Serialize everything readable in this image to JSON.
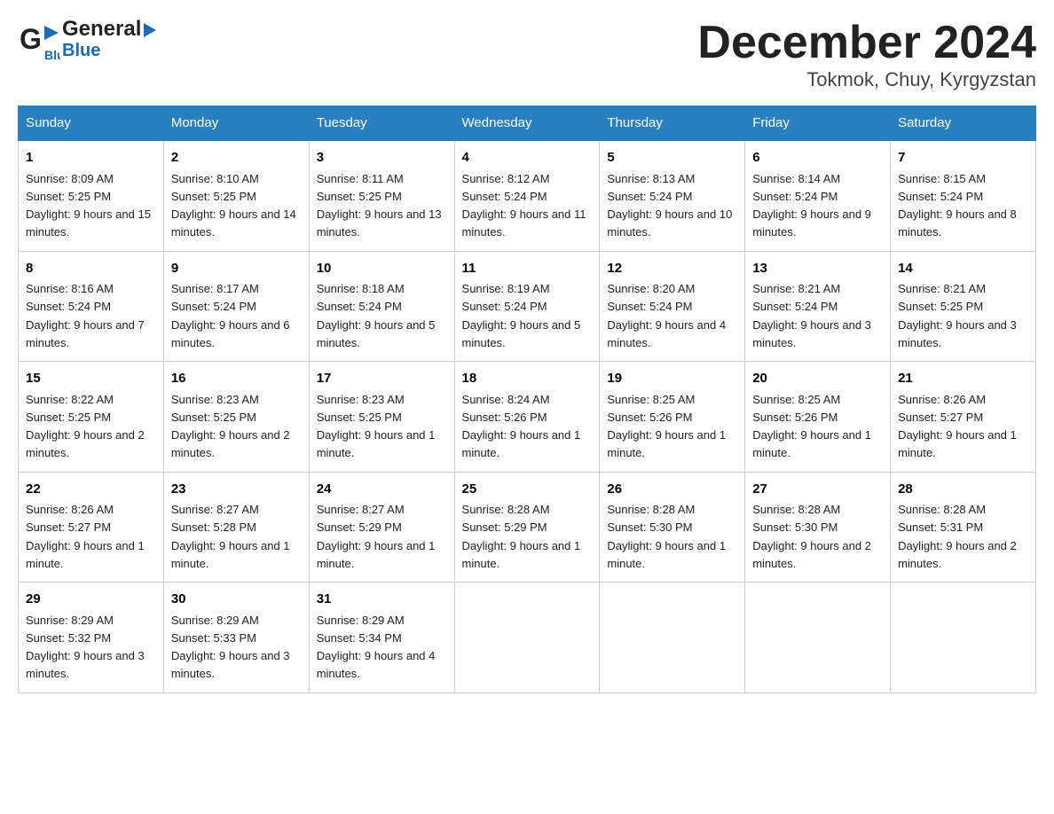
{
  "header": {
    "logo_general": "General",
    "logo_blue": "Blue",
    "title": "December 2024",
    "subtitle": "Tokmok, Chuy, Kyrgyzstan"
  },
  "days_of_week": [
    "Sunday",
    "Monday",
    "Tuesday",
    "Wednesday",
    "Thursday",
    "Friday",
    "Saturday"
  ],
  "weeks": [
    [
      {
        "num": "1",
        "sunrise": "8:09 AM",
        "sunset": "5:25 PM",
        "daylight": "9 hours and 15 minutes."
      },
      {
        "num": "2",
        "sunrise": "8:10 AM",
        "sunset": "5:25 PM",
        "daylight": "9 hours and 14 minutes."
      },
      {
        "num": "3",
        "sunrise": "8:11 AM",
        "sunset": "5:25 PM",
        "daylight": "9 hours and 13 minutes."
      },
      {
        "num": "4",
        "sunrise": "8:12 AM",
        "sunset": "5:24 PM",
        "daylight": "9 hours and 11 minutes."
      },
      {
        "num": "5",
        "sunrise": "8:13 AM",
        "sunset": "5:24 PM",
        "daylight": "9 hours and 10 minutes."
      },
      {
        "num": "6",
        "sunrise": "8:14 AM",
        "sunset": "5:24 PM",
        "daylight": "9 hours and 9 minutes."
      },
      {
        "num": "7",
        "sunrise": "8:15 AM",
        "sunset": "5:24 PM",
        "daylight": "9 hours and 8 minutes."
      }
    ],
    [
      {
        "num": "8",
        "sunrise": "8:16 AM",
        "sunset": "5:24 PM",
        "daylight": "9 hours and 7 minutes."
      },
      {
        "num": "9",
        "sunrise": "8:17 AM",
        "sunset": "5:24 PM",
        "daylight": "9 hours and 6 minutes."
      },
      {
        "num": "10",
        "sunrise": "8:18 AM",
        "sunset": "5:24 PM",
        "daylight": "9 hours and 5 minutes."
      },
      {
        "num": "11",
        "sunrise": "8:19 AM",
        "sunset": "5:24 PM",
        "daylight": "9 hours and 5 minutes."
      },
      {
        "num": "12",
        "sunrise": "8:20 AM",
        "sunset": "5:24 PM",
        "daylight": "9 hours and 4 minutes."
      },
      {
        "num": "13",
        "sunrise": "8:21 AM",
        "sunset": "5:24 PM",
        "daylight": "9 hours and 3 minutes."
      },
      {
        "num": "14",
        "sunrise": "8:21 AM",
        "sunset": "5:25 PM",
        "daylight": "9 hours and 3 minutes."
      }
    ],
    [
      {
        "num": "15",
        "sunrise": "8:22 AM",
        "sunset": "5:25 PM",
        "daylight": "9 hours and 2 minutes."
      },
      {
        "num": "16",
        "sunrise": "8:23 AM",
        "sunset": "5:25 PM",
        "daylight": "9 hours and 2 minutes."
      },
      {
        "num": "17",
        "sunrise": "8:23 AM",
        "sunset": "5:25 PM",
        "daylight": "9 hours and 1 minute."
      },
      {
        "num": "18",
        "sunrise": "8:24 AM",
        "sunset": "5:26 PM",
        "daylight": "9 hours and 1 minute."
      },
      {
        "num": "19",
        "sunrise": "8:25 AM",
        "sunset": "5:26 PM",
        "daylight": "9 hours and 1 minute."
      },
      {
        "num": "20",
        "sunrise": "8:25 AM",
        "sunset": "5:26 PM",
        "daylight": "9 hours and 1 minute."
      },
      {
        "num": "21",
        "sunrise": "8:26 AM",
        "sunset": "5:27 PM",
        "daylight": "9 hours and 1 minute."
      }
    ],
    [
      {
        "num": "22",
        "sunrise": "8:26 AM",
        "sunset": "5:27 PM",
        "daylight": "9 hours and 1 minute."
      },
      {
        "num": "23",
        "sunrise": "8:27 AM",
        "sunset": "5:28 PM",
        "daylight": "9 hours and 1 minute."
      },
      {
        "num": "24",
        "sunrise": "8:27 AM",
        "sunset": "5:29 PM",
        "daylight": "9 hours and 1 minute."
      },
      {
        "num": "25",
        "sunrise": "8:28 AM",
        "sunset": "5:29 PM",
        "daylight": "9 hours and 1 minute."
      },
      {
        "num": "26",
        "sunrise": "8:28 AM",
        "sunset": "5:30 PM",
        "daylight": "9 hours and 1 minute."
      },
      {
        "num": "27",
        "sunrise": "8:28 AM",
        "sunset": "5:30 PM",
        "daylight": "9 hours and 2 minutes."
      },
      {
        "num": "28",
        "sunrise": "8:28 AM",
        "sunset": "5:31 PM",
        "daylight": "9 hours and 2 minutes."
      }
    ],
    [
      {
        "num": "29",
        "sunrise": "8:29 AM",
        "sunset": "5:32 PM",
        "daylight": "9 hours and 3 minutes."
      },
      {
        "num": "30",
        "sunrise": "8:29 AM",
        "sunset": "5:33 PM",
        "daylight": "9 hours and 3 minutes."
      },
      {
        "num": "31",
        "sunrise": "8:29 AM",
        "sunset": "5:34 PM",
        "daylight": "9 hours and 4 minutes."
      },
      null,
      null,
      null,
      null
    ]
  ],
  "labels": {
    "sunrise_prefix": "Sunrise: ",
    "sunset_prefix": "Sunset: ",
    "daylight_prefix": "Daylight: "
  }
}
